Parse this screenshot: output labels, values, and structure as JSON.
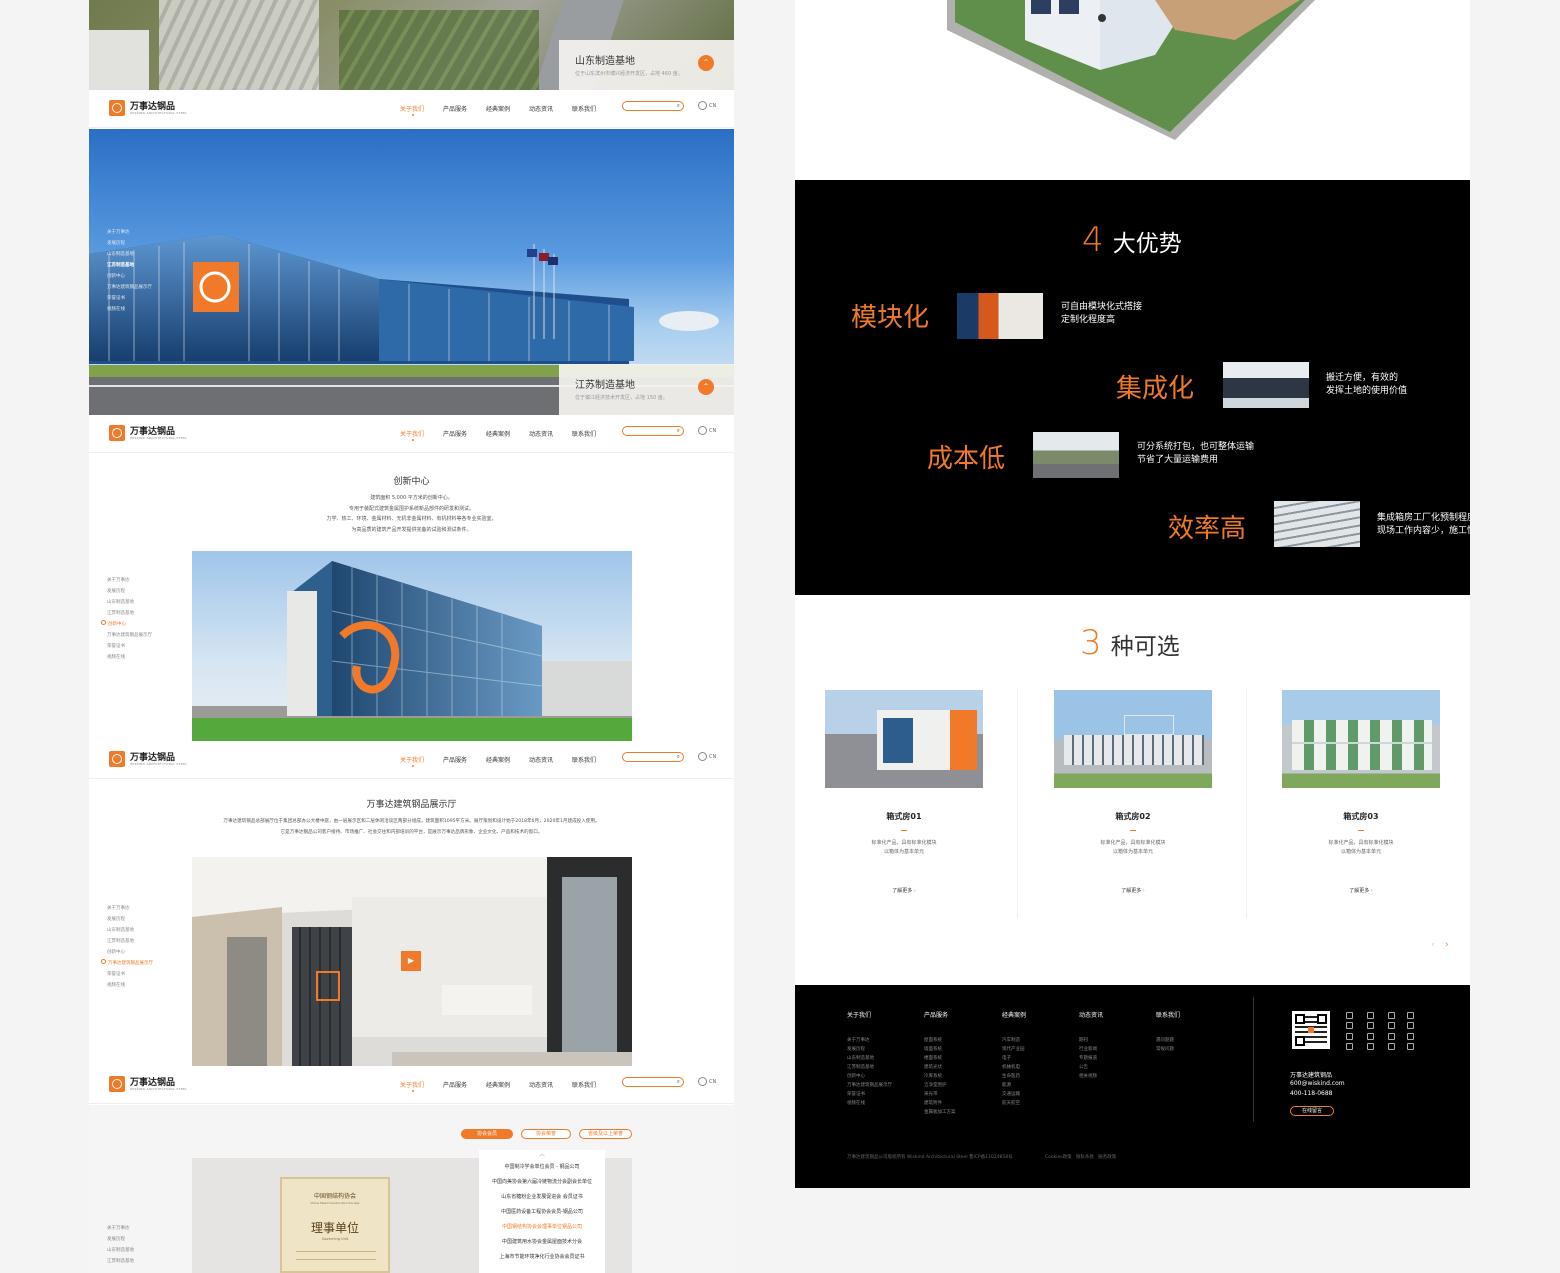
{
  "nav": {
    "brand": "万事达钢品",
    "brand_sub": "WISKIND ARCHITECTURAL STEEL",
    "items": [
      "关于我们",
      "产品服务",
      "经典案例",
      "动态资讯",
      "联系我们"
    ],
    "lang_label": "CN",
    "search_icon": "search-icon"
  },
  "shandong": {
    "title": "山东制造基地",
    "desc": "位于山东滨州市博兴经济开发区，占地 460 亩。"
  },
  "jiangsu": {
    "title": "江苏制造基地",
    "desc": "位于镇江经济技术开发区，占地 150 亩。"
  },
  "sidenav1": [
    "关于万事达",
    "发展历程",
    "山东制造基地",
    "江苏制造基地",
    "创新中心",
    "万事达建筑钢品展示厅",
    "荣誉证书",
    "视频在线"
  ],
  "innovation": {
    "title": "创新中心",
    "lines": [
      "建筑面积 5,000 平方米的创新中心，",
      "专用于装配式建筑金属围护系统新品部件的研发和测试。",
      "力学、热工、环境、金属材料、无机非金属材料、有机材料等各专业实验室，",
      "为高品质的建筑产品开发提供完备的试验和测试条件。"
    ]
  },
  "showroom": {
    "title": "万事达建筑钢品展示厅",
    "lines": [
      "万事达建筑钢品总部展厅位于集团总部办公大楼中庭，由一层展示区和二层休闲洽谈区两部分组成，建筑面积1095平方米。展厅策划和设计始于2018年6月，2020年1月建成投入使用。",
      "它是万事达钢品公司客户接待、市场推广、社会交往和内部培训的平台，是展示万事达品牌形象、企业文化、产品和技术的窗口。"
    ]
  },
  "honors": {
    "tabs": [
      "协会会员",
      "协会荣誉",
      "省级及以上荣誉"
    ],
    "cert_org": "中国钢结构协会",
    "cert_en": "China Steel Construction Society",
    "cert_title": "理事单位",
    "cert_title_en": "Governing Unit",
    "list": [
      "中国制冷学会单位会员 - 钢品公司",
      "中国向美协会第六届冷链物流分会副会长单位",
      "山东省糖粉企业发展促进会 会员证书",
      "中国医药设备工程协会会员-钢品公司",
      "中国钢结构协会会理事单位钢品公司",
      "中国建筑用水协会金属屋面技术分会",
      "上海市节能环境净化行业协会会员证书"
    ],
    "active_index": 4
  },
  "advantages": {
    "number": "4",
    "title": "大优势",
    "items": [
      {
        "word": "模块化",
        "lines": [
          "可自由模块化式搭接",
          "定制化程度高"
        ]
      },
      {
        "word": "集成化",
        "lines": [
          "搬迁方便，有效的",
          "发挥土地的使用价值"
        ]
      },
      {
        "word": "成本低",
        "lines": [
          "可分系统打包，也可整体运输",
          "节省了大量运输费用"
        ]
      },
      {
        "word": "效率高",
        "lines": [
          "集成箱房工厂化预制程度高",
          "现场工作内容少，施工快"
        ]
      }
    ]
  },
  "options": {
    "number": "3",
    "title": "种可选",
    "items": [
      {
        "name": "箱式房01",
        "desc": [
          "标准化产品，具有标准化模块",
          "以箱体为基本单元"
        ],
        "more": "了解更多"
      },
      {
        "name": "箱式房02",
        "desc": [
          "标准化产品，具有标准化模块",
          "以箱体为基本单元"
        ],
        "more": "了解更多"
      },
      {
        "name": "箱式房03",
        "desc": [
          "标准化产品，具有标准化模块",
          "以箱体为基本单元"
        ],
        "more": "了解更多"
      }
    ]
  },
  "footer": {
    "cols": [
      {
        "title": "关于我们",
        "links": [
          "关于万事达",
          "发展历程",
          "山东制造基地",
          "江苏制造基地",
          "创新中心",
          "万事达建筑钢品展示厅",
          "荣誉证书",
          "视频在线"
        ]
      },
      {
        "title": "产品服务",
        "links": [
          "屋面系统",
          "墙面系统",
          "楼面系统",
          "建筑光伏",
          "冷库系统",
          "洁净室围护",
          "采光带",
          "建筑附件",
          "金属板加工方案"
        ]
      },
      {
        "title": "经典案例",
        "links": [
          "汽车制造",
          "现代产业园",
          "电子",
          "机械机电",
          "生命医药",
          "能源",
          "交通运输",
          "航天航空"
        ]
      },
      {
        "title": "动态资讯",
        "links": [
          "期刊",
          "行业新闻",
          "专题报道",
          "公告",
          "相关视频"
        ]
      },
      {
        "title": "联系我们",
        "links": [
          "遇问题题",
          "常规问题"
        ]
      }
    ],
    "company": "万事达建筑钢品",
    "email": "600@wiskind.com",
    "phone": "400-118-0688",
    "button": "在线留言",
    "copyright": "万事达建筑钢品公司版权所有 Wiskind Architectural Steel 鲁ICP备11024858号",
    "links": [
      "Cookies政策",
      "隐私条款",
      "服务政策"
    ]
  },
  "colors": {
    "accent": "#f07a2a",
    "dark": "#000000"
  }
}
